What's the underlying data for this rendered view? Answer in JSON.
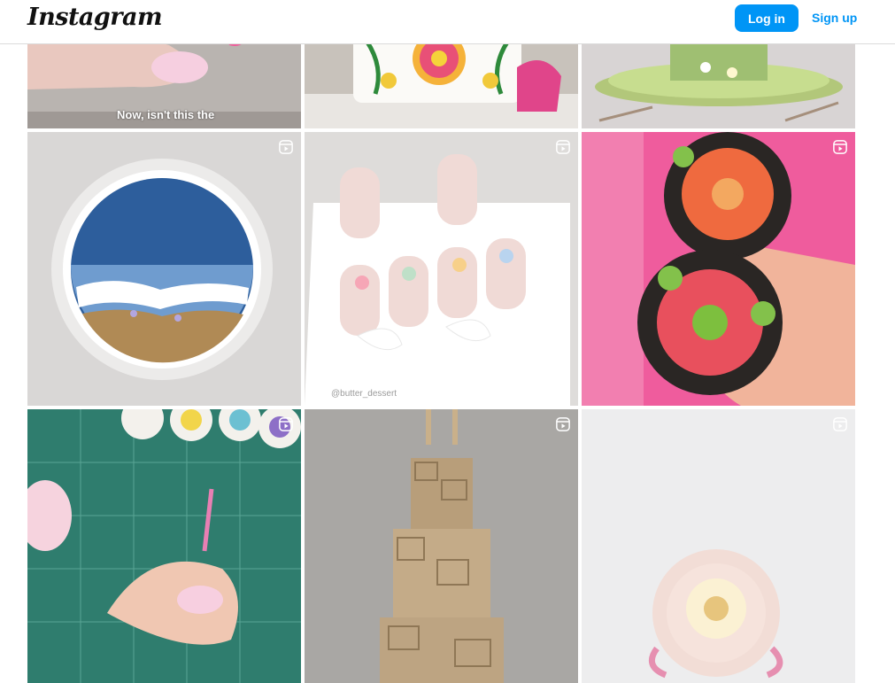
{
  "header": {
    "logo_text": "Instagram",
    "login_label": "Log in",
    "signup_label": "Sign up"
  },
  "colors": {
    "accent": "#0095f6",
    "border": "#dbdbdb"
  },
  "posts": [
    {
      "name": "nail-fondant-post",
      "caption_overlay": "Now, isn't this the",
      "is_reel": false
    },
    {
      "name": "embroidered-cake-post",
      "is_reel": false
    },
    {
      "name": "green-cake-post",
      "is_reel": false
    },
    {
      "name": "ocean-cake-post",
      "is_reel": true
    },
    {
      "name": "cakesicles-box-post",
      "watermark": "@butter_dessert",
      "is_reel": true
    },
    {
      "name": "flower-cupcakes-post",
      "is_reel": true
    },
    {
      "name": "fondant-modeling-post",
      "is_reel": true
    },
    {
      "name": "wood-block-cake-post",
      "is_reel": true
    },
    {
      "name": "piped-flower-cupcake-post",
      "is_reel": true
    }
  ],
  "icons": {
    "reel": "reel-icon"
  }
}
